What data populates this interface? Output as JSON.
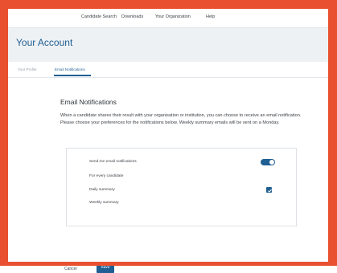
{
  "nav": {
    "items": [
      "Candidate Search",
      "Downloads",
      "Your Organization",
      "Help"
    ]
  },
  "page": {
    "title": "Your Account"
  },
  "tabs": [
    {
      "label": "Your Profile",
      "active": false
    },
    {
      "label": "Email Notifications",
      "active": true
    }
  ],
  "email_notifications": {
    "heading": "Email Notifications",
    "description": "When a candidate shares their result with your organisation or institution, you can choose to receive an email notification. Please choose your preferences for the notifications below. Weekly summary emails will be sent on a Monday.",
    "send_toggle": {
      "label": "Send me email notifications",
      "on": true
    },
    "options": [
      {
        "label": "For every candidate",
        "checked": false
      },
      {
        "label": "Daily summary",
        "checked": true
      },
      {
        "label": "Weekly summary",
        "checked": false
      }
    ]
  },
  "actions": {
    "cancel_label": "Cancel",
    "save_label": "Save"
  },
  "colors": {
    "accent": "#1f5f93",
    "frame": "#e8502f"
  }
}
